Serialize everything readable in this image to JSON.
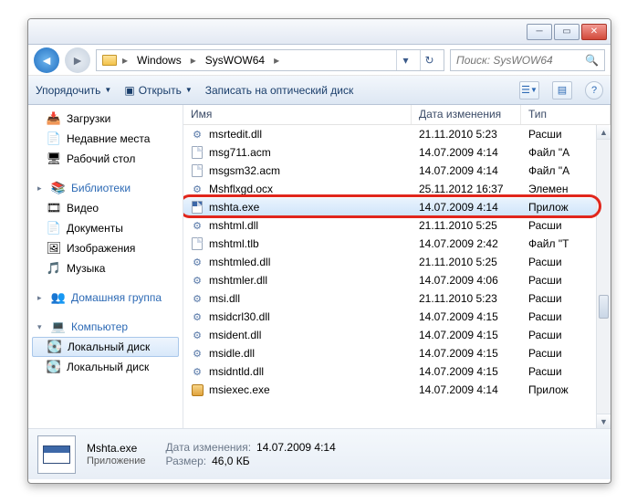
{
  "breadcrumb": {
    "seg0": "Windows",
    "seg1": "SysWOW64"
  },
  "search": {
    "placeholder": "Поиск: SysWOW64"
  },
  "toolbar": {
    "organize": "Упорядочить",
    "open": "Открыть",
    "burn": "Записать на оптический диск"
  },
  "columns": {
    "name": "Имя",
    "date": "Дата изменения",
    "type": "Тип"
  },
  "nav": {
    "downloads": "Загрузки",
    "recent": "Недавние места",
    "desktop": "Рабочий стол",
    "libraries": "Библиотеки",
    "video": "Видео",
    "documents": "Документы",
    "pictures": "Изображения",
    "music": "Музыка",
    "homegroup": "Домашняя группа",
    "computer": "Компьютер",
    "localdisk": "Локальный диск",
    "localdisk2": "Локальный диск"
  },
  "files": [
    {
      "name": "msrtedit.dll",
      "date": "21.11.2010 5:23",
      "type": "Расши",
      "icon": "gear"
    },
    {
      "name": "msg711.acm",
      "date": "14.07.2009 4:14",
      "type": "Файл \"A",
      "icon": "page"
    },
    {
      "name": "msgsm32.acm",
      "date": "14.07.2009 4:14",
      "type": "Файл \"A",
      "icon": "page"
    },
    {
      "name": "Mshflxgd.ocx",
      "date": "25.11.2012 16:37",
      "type": "Элемен",
      "icon": "gear"
    },
    {
      "name": "mshta.exe",
      "date": "14.07.2009 4:14",
      "type": "Прилож",
      "icon": "exe",
      "selected": true,
      "highlight": true
    },
    {
      "name": "mshtml.dll",
      "date": "21.11.2010 5:25",
      "type": "Расши",
      "icon": "gear"
    },
    {
      "name": "mshtml.tlb",
      "date": "14.07.2009 2:42",
      "type": "Файл \"T",
      "icon": "page"
    },
    {
      "name": "mshtmled.dll",
      "date": "21.11.2010 5:25",
      "type": "Расши",
      "icon": "gear"
    },
    {
      "name": "mshtmler.dll",
      "date": "14.07.2009 4:06",
      "type": "Расши",
      "icon": "gear"
    },
    {
      "name": "msi.dll",
      "date": "21.11.2010 5:23",
      "type": "Расши",
      "icon": "gear"
    },
    {
      "name": "msidcrl30.dll",
      "date": "14.07.2009 4:15",
      "type": "Расши",
      "icon": "gear"
    },
    {
      "name": "msident.dll",
      "date": "14.07.2009 4:15",
      "type": "Расши",
      "icon": "gear"
    },
    {
      "name": "msidle.dll",
      "date": "14.07.2009 4:15",
      "type": "Расши",
      "icon": "gear"
    },
    {
      "name": "msidntld.dll",
      "date": "14.07.2009 4:15",
      "type": "Расши",
      "icon": "gear"
    },
    {
      "name": "msiexec.exe",
      "date": "14.07.2009 4:14",
      "type": "Прилож",
      "icon": "msi"
    }
  ],
  "details": {
    "filename": "Mshta.exe",
    "filetype": "Приложение",
    "mod_label": "Дата изменения:",
    "mod_value": "14.07.2009 4:14",
    "size_label": "Размер:",
    "size_value": "46,0 КБ"
  }
}
